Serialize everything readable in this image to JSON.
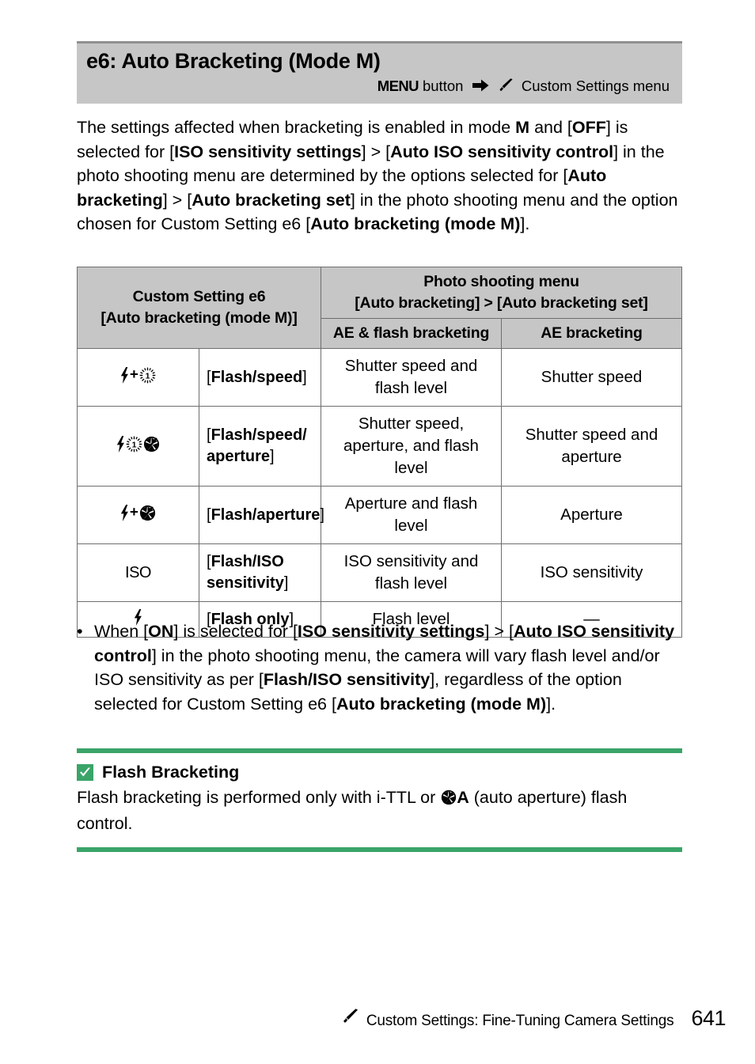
{
  "header": {
    "title": "e6: Auto Bracketing (Mode M)",
    "menu_button_label": "MENU",
    "button_word": "button",
    "arrow_icon": "right-arrow-icon",
    "pencil_icon": "pencil-icon",
    "menu_path": "Custom Settings menu"
  },
  "intro": {
    "segments": [
      {
        "text": "The settings affected when bracketing is enabled in mode ",
        "bold": false
      },
      {
        "text": "M",
        "bold": true
      },
      {
        "text": " and [",
        "bold": false
      },
      {
        "text": "OFF",
        "bold": true
      },
      {
        "text": "] is selected for [",
        "bold": false
      },
      {
        "text": "ISO sensitivity settings",
        "bold": true
      },
      {
        "text": "] > [",
        "bold": false
      },
      {
        "text": "Auto ISO sensitivity control",
        "bold": true
      },
      {
        "text": "] in the photo shooting menu are determined by the options selected for [",
        "bold": false
      },
      {
        "text": "Auto bracketing",
        "bold": true
      },
      {
        "text": "] > [",
        "bold": false
      },
      {
        "text": "Auto bracketing set",
        "bold": true
      },
      {
        "text": "] in the photo shooting menu and the option chosen for Custom Setting e6 [",
        "bold": false
      },
      {
        "text": "Auto bracketing (mode M)",
        "bold": true
      },
      {
        "text": "].",
        "bold": false
      }
    ]
  },
  "table": {
    "header": {
      "left_group_line1": "Custom Setting e6",
      "left_group_line2": "[Auto bracketing (mode M)]",
      "right_group_line1": "Photo shooting menu",
      "right_group_line2": "[Auto bracketing] > [Auto bracketing set]",
      "col_ae_flash": "AE & flash bracketing",
      "col_ae": "AE bracketing"
    },
    "rows": [
      {
        "icon": "flash-plus-shutter-speed-icon",
        "icon_kind": "flash_plus_speed",
        "option_prefix": "[",
        "option_bold": "Flash/speed",
        "option_suffix": "]",
        "ae_flash": "Shutter speed and flash level",
        "ae": "Shutter speed"
      },
      {
        "icon": "flash-shutter-speed-aperture-icon",
        "icon_kind": "flash_speed_aperture",
        "option_prefix": "[",
        "option_bold": "Flash/speed/ aperture",
        "option_suffix": "]",
        "ae_flash": "Shutter speed, aperture, and flash level",
        "ae": "Shutter speed and aperture"
      },
      {
        "icon": "flash-plus-aperture-icon",
        "icon_kind": "flash_plus_aperture",
        "option_prefix": "[",
        "option_bold": "Flash/aperture",
        "option_suffix": "]",
        "ae_flash": "Aperture and flash level",
        "ae": "Aperture"
      },
      {
        "icon": "iso-icon",
        "icon_kind": "iso",
        "icon_text": "ISO",
        "option_prefix": "[",
        "option_bold": "Flash/ISO sensitivity",
        "option_suffix": "]",
        "ae_flash": "ISO sensitivity and flash level",
        "ae": "ISO sensitivity"
      },
      {
        "icon": "flash-icon",
        "icon_kind": "flash",
        "option_prefix": "[",
        "option_bold": "Flash only",
        "option_suffix": "]",
        "ae_flash": "Flash level",
        "ae": "—"
      }
    ]
  },
  "bullet": {
    "marker": "•",
    "segments": [
      {
        "text": "When [",
        "bold": false
      },
      {
        "text": "ON",
        "bold": true
      },
      {
        "text": "] is selected for [",
        "bold": false
      },
      {
        "text": "ISO sensitivity settings",
        "bold": true
      },
      {
        "text": "] > [",
        "bold": false
      },
      {
        "text": "Auto ISO sensitivity control",
        "bold": true
      },
      {
        "text": "] in the photo shooting menu, the camera will vary flash level and/or ISO sensitivity as per [",
        "bold": false
      },
      {
        "text": "Flash/ISO sensitivity",
        "bold": true
      },
      {
        "text": "], regardless of the option selected for Custom Setting e6 [",
        "bold": false
      },
      {
        "text": "Auto bracketing (mode M)",
        "bold": true
      },
      {
        "text": "].",
        "bold": false
      }
    ]
  },
  "note": {
    "icon": "checkbox-check-icon",
    "title": "Flash Bracketing",
    "body_before": "Flash bracketing is performed only with i-TTL or ",
    "aperture_icon": "aperture-icon",
    "body_a": "A",
    "body_after": " (auto aperture) flash control."
  },
  "footer": {
    "pencil_icon": "pencil-icon",
    "text": "Custom Settings: Fine-Tuning Camera Settings",
    "page_number": "641"
  },
  "colors": {
    "header_bar": "#c6c6c6",
    "header_rule": "#8f8f8f",
    "note_green": "#3aa468",
    "table_border": "#6e6e6e"
  }
}
